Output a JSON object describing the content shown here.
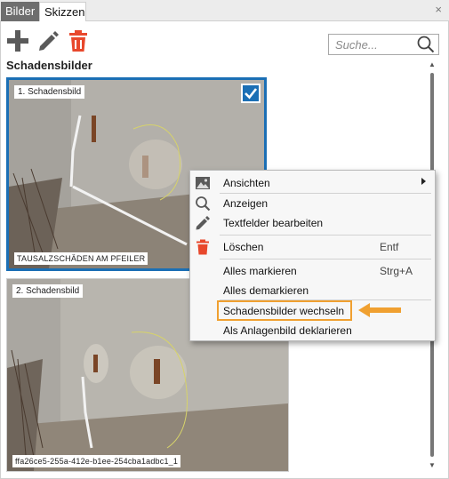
{
  "tabs": [
    {
      "label": "Bilder",
      "active": true
    },
    {
      "label": "Skizzen",
      "active": false
    }
  ],
  "close_label": "×",
  "toolbar": {
    "icons": [
      "plus-icon",
      "pencil-icon",
      "trash-icon"
    ],
    "colors": {
      "icon_gray": "#5a5a5a",
      "delete_red": "#e8482c"
    }
  },
  "search": {
    "placeholder": "Suche..."
  },
  "section_title": "Schadensbilder",
  "cards": [
    {
      "label": "1. Schadensbild",
      "caption": "TAUSALZSCHÄDEN AM PFEILER",
      "selected": true
    },
    {
      "label": "2. Schadensbild",
      "caption": "ffa26ce5-255a-412e-b1ee-254cba1adbc1_1",
      "selected": false
    }
  ],
  "context_menu": {
    "items": [
      {
        "label": "Ansichten",
        "icon": "image-icon",
        "has_submenu": true
      },
      {
        "label": "Anzeigen",
        "icon": "search-icon"
      },
      {
        "label": "Textfelder bearbeiten",
        "icon": "pencil-icon"
      },
      {
        "label": "Löschen",
        "icon": "trash-icon",
        "shortcut": "Entf"
      },
      {
        "label": "Alles markieren",
        "shortcut": "Strg+A"
      },
      {
        "label": "Alles demarkieren"
      },
      {
        "label": "Schadensbilder wechseln",
        "highlighted": true
      },
      {
        "label": "Als Anlagenbild deklarieren"
      }
    ]
  },
  "colors": {
    "selection_blue": "#1b6fb5",
    "highlight_orange": "#f0a030",
    "active_tab": "#6e6e6e"
  }
}
